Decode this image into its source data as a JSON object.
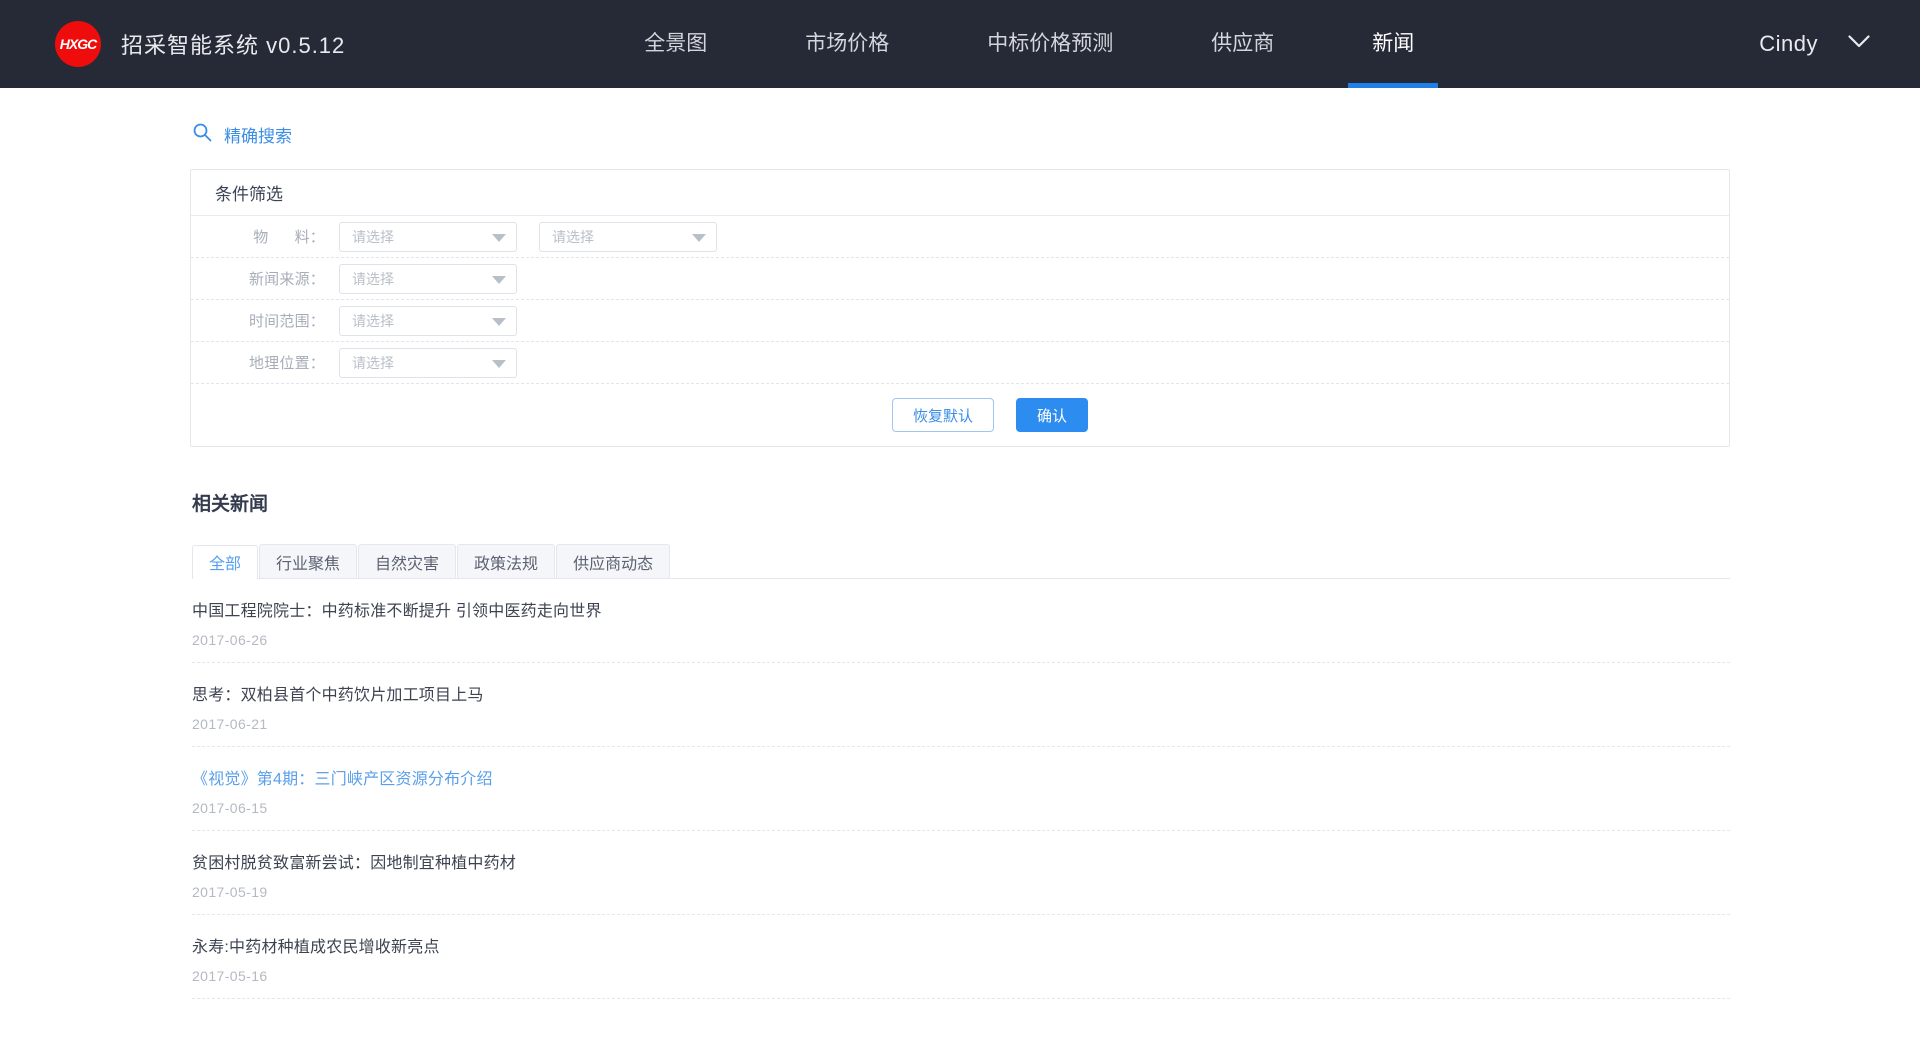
{
  "header": {
    "logo_text": "HXGC",
    "logo_color": "#ef0c0c",
    "title": "招采智能系统 v0.5.12",
    "nav": [
      {
        "label": "全景图",
        "active": false
      },
      {
        "label": "市场价格",
        "active": false
      },
      {
        "label": "中标价格预测",
        "active": false
      },
      {
        "label": "供应商",
        "active": false
      },
      {
        "label": "新闻",
        "active": true
      }
    ],
    "user_name": "Cindy",
    "chevron_icon": "chevron-down-icon",
    "accent_color": "#1f7fe8",
    "background_color": "#262a36"
  },
  "search": {
    "icon": "search-icon",
    "label": "精确搜索",
    "color": "#3a8ee6"
  },
  "filter": {
    "title": "条件筛选",
    "rows": [
      {
        "label": "物      料：",
        "selects": [
          "请选择",
          "请选择"
        ]
      },
      {
        "label": "新闻来源：",
        "selects": [
          "请选择"
        ]
      },
      {
        "label": "时间范围：",
        "selects": [
          "请选择"
        ]
      },
      {
        "label": "地理位置：",
        "selects": [
          "请选择"
        ]
      }
    ],
    "reset_label": "恢复默认",
    "confirm_label": "确认"
  },
  "news_section": {
    "title": "相关新闻",
    "tabs": [
      {
        "label": "全部",
        "active": true
      },
      {
        "label": "行业聚焦",
        "active": false
      },
      {
        "label": "自然灾害",
        "active": false
      },
      {
        "label": "政策法规",
        "active": false
      },
      {
        "label": "供应商动态",
        "active": false
      }
    ],
    "items": [
      {
        "title": "中国工程院院士：中药标准不断提升 引领中医药走向世界",
        "date": "2017-06-26",
        "highlighted": false
      },
      {
        "title": "思考：双柏县首个中药饮片加工项目上马",
        "date": "2017-06-21",
        "highlighted": false
      },
      {
        "title": "《视觉》第4期：三门峡产区资源分布介绍",
        "date": "2017-06-15",
        "highlighted": true
      },
      {
        "title": "贫困村脱贫致富新尝试：因地制宜种植中药材",
        "date": "2017-05-19",
        "highlighted": false
      },
      {
        "title": "永寿:中药材种植成农民增收新亮点",
        "date": "2017-05-16",
        "highlighted": false
      }
    ]
  }
}
